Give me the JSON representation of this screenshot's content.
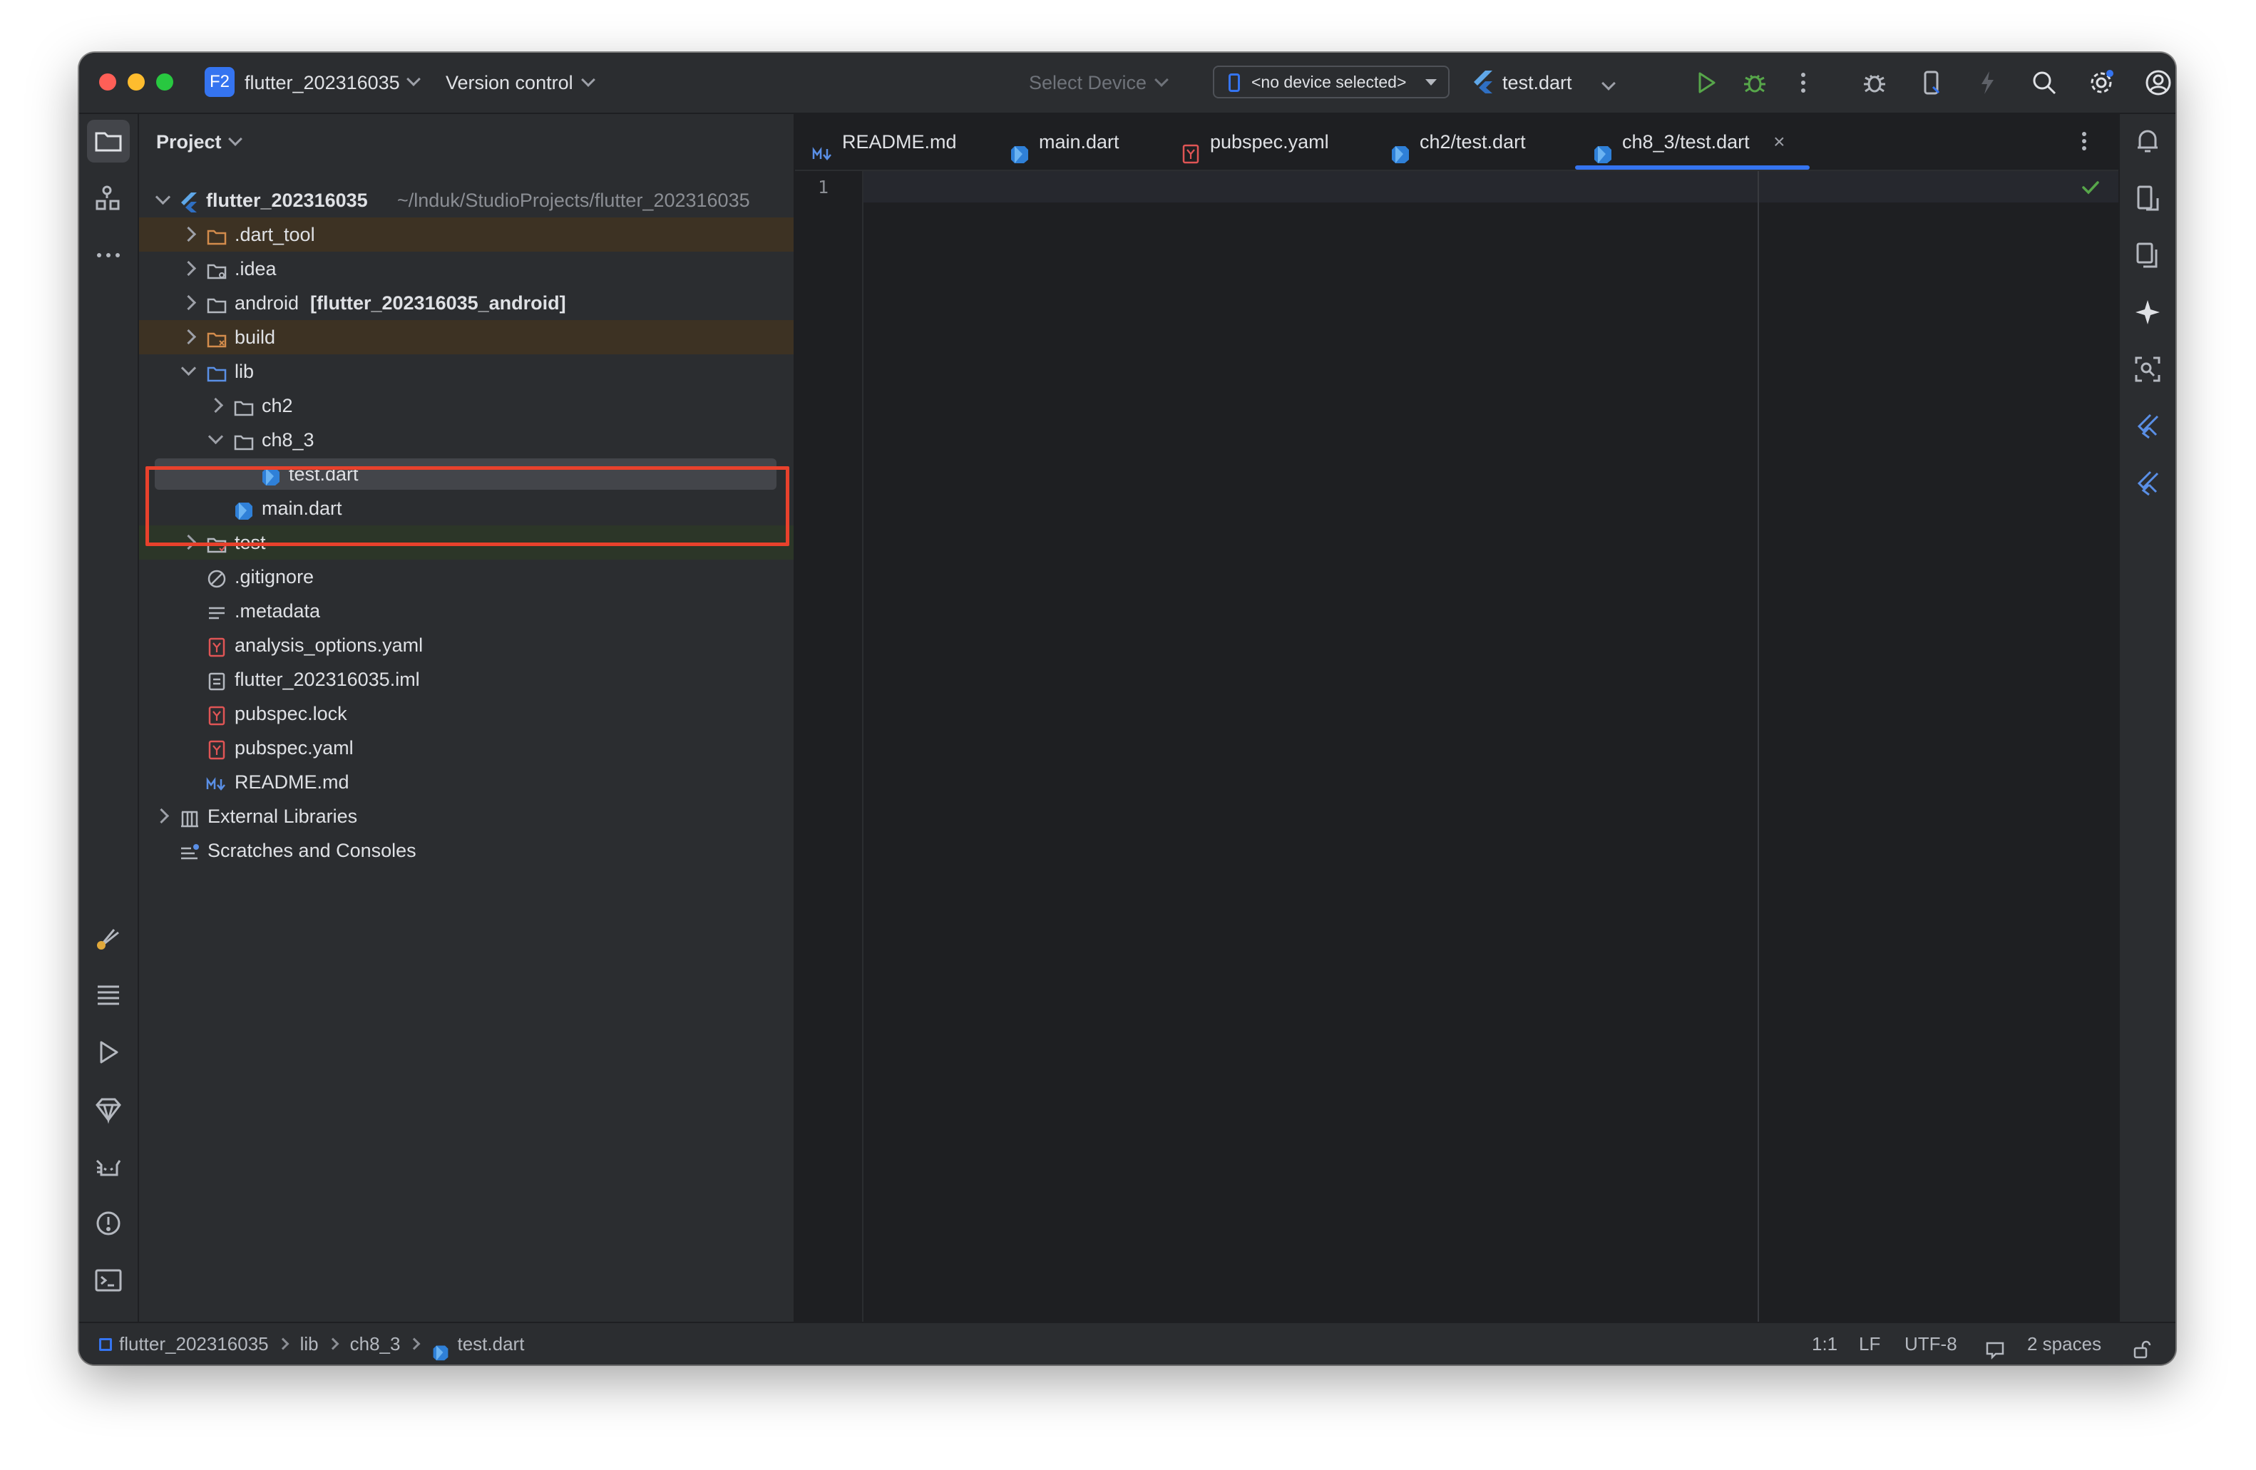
{
  "titlebar": {
    "project_badge": "F2",
    "project_name": "flutter_202316035",
    "version_control": "Version control",
    "select_device": "Select Device",
    "device_dropdown": "<no device selected>",
    "run_config": "test.dart",
    "icons": [
      "run-icon",
      "debug-icon",
      "more-icon",
      "bug-icon",
      "device-manager-icon",
      "hot-reload-icon",
      "search-icon",
      "settings-icon",
      "account-icon"
    ]
  },
  "project_panel": {
    "title": "Project",
    "root": {
      "name": "flutter_202316035",
      "path": "~/lnduk/StudioProjects/flutter_202316035"
    },
    "items": [
      {
        "label": ".dart_tool",
        "kind": "folder-excluded"
      },
      {
        "label": ".idea",
        "kind": "folder-settings"
      },
      {
        "label": "android",
        "suffix": "[flutter_202316035_android]",
        "kind": "folder"
      },
      {
        "label": "build",
        "kind": "folder-excluded"
      },
      {
        "label": "lib",
        "kind": "folder-source"
      },
      {
        "label": "ch2",
        "kind": "folder"
      },
      {
        "label": "ch8_3",
        "kind": "folder"
      },
      {
        "label": "test.dart",
        "kind": "dart"
      },
      {
        "label": "main.dart",
        "kind": "dart"
      },
      {
        "label": "test",
        "kind": "folder-test"
      },
      {
        "label": ".gitignore",
        "kind": "ignore"
      },
      {
        "label": ".metadata",
        "kind": "text"
      },
      {
        "label": "analysis_options.yaml",
        "kind": "yaml"
      },
      {
        "label": "flutter_202316035.iml",
        "kind": "iml"
      },
      {
        "label": "pubspec.lock",
        "kind": "yaml"
      },
      {
        "label": "pubspec.yaml",
        "kind": "yaml"
      },
      {
        "label": "README.md",
        "kind": "markdown"
      },
      {
        "label": "External Libraries",
        "kind": "library"
      },
      {
        "label": "Scratches and Consoles",
        "kind": "scratch"
      }
    ]
  },
  "tabs": [
    {
      "label": "README.md",
      "icon": "markdown-icon"
    },
    {
      "label": "main.dart",
      "icon": "dart-icon"
    },
    {
      "label": "pubspec.yaml",
      "icon": "yaml-icon"
    },
    {
      "label": "ch2/test.dart",
      "icon": "dart-icon"
    },
    {
      "label": "ch8_3/test.dart",
      "icon": "dart-icon",
      "active": true
    }
  ],
  "editor": {
    "line_number": "1"
  },
  "statusbar": {
    "breadcrumb": [
      "flutter_202316035",
      "lib",
      "ch8_3",
      "test.dart"
    ],
    "position": "1:1",
    "line_ending": "LF",
    "encoding": "UTF-8",
    "indent": "2 spaces"
  },
  "colors": {
    "accent": "#3574f0",
    "highlight_box": "#e8412c",
    "excluded_row": "#3d3223",
    "test_row": "#2c3628",
    "selected_row": "#43454a"
  }
}
